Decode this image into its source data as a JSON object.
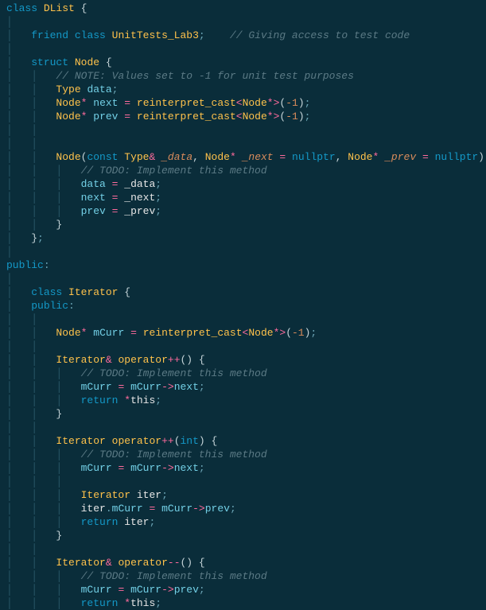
{
  "tokens": {
    "class": "class",
    "friend": "friend",
    "struct": "struct",
    "public": "public",
    "return": "return",
    "const": "const",
    "nullptr": "nullptr",
    "int": "int",
    "DList": "DList",
    "UnitTests_Lab3": "UnitTests_Lab3",
    "Node": "Node",
    "Type": "Type",
    "Iterator": "Iterator",
    "reinterpret_cast": "reinterpret_cast",
    "operator": "operator",
    "data": "data",
    "next": "next",
    "prev": "prev",
    "mCurr": "mCurr",
    "iter": "iter",
    "this": "this",
    "p_data": "_data",
    "p_next": "_next",
    "p_prev": "_prev",
    "neg1": "-1",
    "c_access": "// Giving access to test code",
    "c_note": "// NOTE: Values set to -1 for unit test purposes",
    "c_todo": "// TODO: Implement this method"
  }
}
